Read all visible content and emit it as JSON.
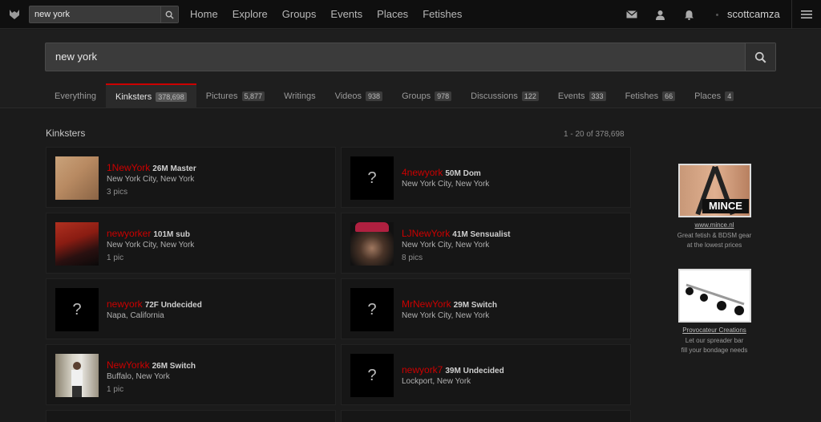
{
  "topbar": {
    "search_value": "new york",
    "nav": [
      "Home",
      "Explore",
      "Groups",
      "Events",
      "Places",
      "Fetishes"
    ],
    "username": "scottcamza"
  },
  "search": {
    "value": "new york"
  },
  "tabs": [
    {
      "label": "Everything",
      "count": ""
    },
    {
      "label": "Kinksters",
      "count": "378,698"
    },
    {
      "label": "Pictures",
      "count": "5,877"
    },
    {
      "label": "Writings",
      "count": ""
    },
    {
      "label": "Videos",
      "count": "938"
    },
    {
      "label": "Groups",
      "count": "978"
    },
    {
      "label": "Discussions",
      "count": "122"
    },
    {
      "label": "Events",
      "count": "333"
    },
    {
      "label": "Fetishes",
      "count": "66"
    },
    {
      "label": "Places",
      "count": "4"
    }
  ],
  "section": {
    "title": "Kinksters",
    "range": "1 - 20 of 378,698"
  },
  "results": [
    {
      "name": "1NewYork",
      "meta": "26M Master",
      "location": "New York City, New York",
      "pics": "3 pics",
      "avatar": "photo-skin"
    },
    {
      "name": "4newyork",
      "meta": "50M Dom",
      "location": "New York City, New York",
      "pics": "",
      "avatar": "placeholder"
    },
    {
      "name": "newyorker",
      "meta": "101M sub",
      "location": "New York City, New York",
      "pics": "1 pic",
      "avatar": "photo-red"
    },
    {
      "name": "LJNewYork",
      "meta": "41M Sensualist",
      "location": "New York City, New York",
      "pics": "8 pics",
      "avatar": "photo-face"
    },
    {
      "name": "newyork",
      "meta": "72F Undecided",
      "location": "Napa, California",
      "pics": "",
      "avatar": "placeholder"
    },
    {
      "name": "MrNewYork",
      "meta": "29M Switch",
      "location": "New York City, New York",
      "pics": "",
      "avatar": "placeholder"
    },
    {
      "name": "NewYorkk",
      "meta": "26M Switch",
      "location": "Buffalo, New York",
      "pics": "1 pic",
      "avatar": "photo-mirror"
    },
    {
      "name": "newyork7",
      "meta": "39M Undecided",
      "location": "Lockport, New York",
      "pics": "",
      "avatar": "placeholder"
    }
  ],
  "placeholder_glyph": "?",
  "ads": [
    {
      "image_text": "MINCE",
      "link": "www.mince.nl",
      "text": [
        "Great fetish & BDSM gear",
        "at the lowest prices"
      ]
    },
    {
      "link": "Provocateur Creations",
      "text": [
        "Let our spreader bar",
        "fill your bondage needs"
      ]
    }
  ],
  "colors": {
    "accent": "#cc0000",
    "background": "#1b1b1b",
    "card": "#161616",
    "topbar": "#0f0f0f"
  }
}
